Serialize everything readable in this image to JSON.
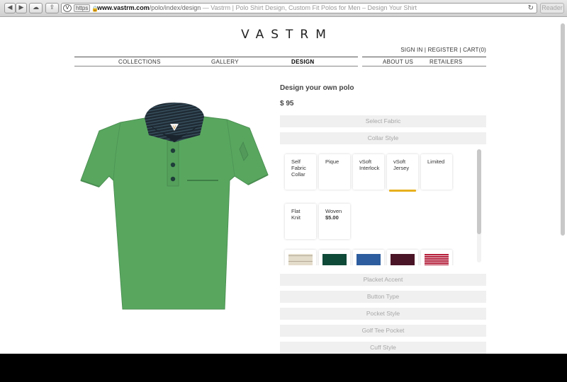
{
  "browser": {
    "https_label": "https",
    "url_host": "www.vastrm.com",
    "url_path": "/polo/index/design",
    "page_title": " — Vastrm | Polo Shirt Design, Custom Fit Polos for Men – Design Your Shirt",
    "reader_label": "Reader"
  },
  "site": {
    "logo": "VASTRM",
    "account": {
      "sign_in": "SIGN IN",
      "sep1": " | ",
      "register": "REGISTER",
      "sep2": " | ",
      "cart": "CART(0)"
    },
    "nav_left": [
      "COLLECTIONS",
      "GALLERY",
      "DESIGN"
    ],
    "nav_right": [
      "ABOUT US",
      "RETAILERS"
    ],
    "active_nav": "DESIGN"
  },
  "design": {
    "title": "Design your own polo",
    "price": "$ 95",
    "sections_top": [
      "Select Fabric",
      "Collar Style"
    ],
    "collar_options": [
      {
        "label": "Self Fabric Collar",
        "lines": [
          "Self",
          "Fabric",
          "Collar"
        ],
        "price": ""
      },
      {
        "label": "Pique",
        "lines": [
          "Pique"
        ],
        "price": ""
      },
      {
        "label": "vSoft Interlock",
        "lines": [
          "vSoft",
          "Interlock"
        ],
        "price": ""
      },
      {
        "label": "vSoft Jersey",
        "lines": [
          "vSoft",
          "Jersey"
        ],
        "price": "",
        "selected": true
      },
      {
        "label": "Limited",
        "lines": [
          "Limited"
        ],
        "price": ""
      },
      {
        "label": "Flat Knit",
        "lines": [
          "Flat",
          "Knit"
        ],
        "price": ""
      },
      {
        "label": "Woven",
        "lines": [
          "Woven"
        ],
        "price": "$5.00"
      }
    ],
    "fabric_swatches": [
      {
        "name": "beige-stripe-swatch",
        "color": "#e4dccb",
        "stripe": "#b5ab97"
      },
      {
        "name": "dark-green-swatch",
        "color": "#0f4a38",
        "stripe": "#0f4a38"
      },
      {
        "name": "blue-swatch",
        "color": "#2d5d9e",
        "stripe": "#2d5d9e"
      },
      {
        "name": "burgundy-swatch",
        "color": "#4a1526",
        "stripe": "#4a1526"
      },
      {
        "name": "red-stripe-swatch",
        "color": "#b71f3b",
        "stripe": "#e8d0d6"
      }
    ],
    "sections_bottom": [
      "Placket Accent",
      "Button Type",
      "Pocket Style",
      "Golf Tee Pocket",
      "Cuff Style"
    ],
    "colors": {
      "accent": "#e8b01e",
      "shirt": "#59a75f",
      "collar": "#1f2b35"
    }
  }
}
